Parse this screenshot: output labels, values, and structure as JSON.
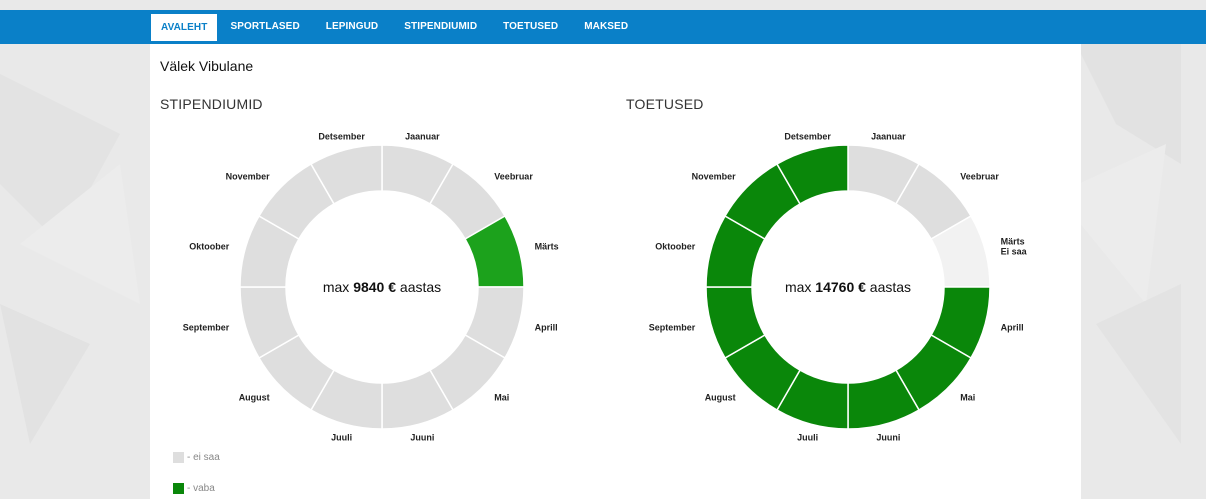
{
  "nav": {
    "items": [
      {
        "label": "AVALEHT",
        "active": true
      },
      {
        "label": "SPORTLASED",
        "active": false
      },
      {
        "label": "LEPINGUD",
        "active": false
      },
      {
        "label": "STIPENDIUMID",
        "active": false
      },
      {
        "label": "TOETUSED",
        "active": false
      },
      {
        "label": "MAKSED",
        "active": false
      }
    ]
  },
  "user_name": "Välek Vibulane",
  "colors": {
    "nav_bg": "#0a80c8",
    "vaba": "#0a870a",
    "vaba_light": "#1ca21c",
    "ei_saa": "#dedede",
    "light": "#f2f2f2"
  },
  "legend": {
    "ei_saa": "- ei saa",
    "vaba": "- vaba"
  },
  "chart_data": [
    {
      "type": "donut",
      "title": "STIPENDIUMID",
      "center": {
        "prefix": "max ",
        "amount": "9840 €",
        "suffix": " aastas"
      },
      "segments": [
        {
          "month": "Jaanuar",
          "status": "ei saa"
        },
        {
          "month": "Veebruar",
          "status": "ei saa"
        },
        {
          "month": "Märts",
          "status": "vaba"
        },
        {
          "month": "Aprill",
          "status": "ei saa"
        },
        {
          "month": "Mai",
          "status": "ei saa"
        },
        {
          "month": "Juuni",
          "status": "ei saa"
        },
        {
          "month": "Juuli",
          "status": "ei saa"
        },
        {
          "month": "August",
          "status": "ei saa"
        },
        {
          "month": "September",
          "status": "ei saa"
        },
        {
          "month": "Oktoober",
          "status": "ei saa"
        },
        {
          "month": "November",
          "status": "ei saa"
        },
        {
          "month": "Detsember",
          "status": "ei saa"
        }
      ]
    },
    {
      "type": "donut",
      "title": "TOETUSED",
      "center": {
        "prefix": "max ",
        "amount": "14760 €",
        "suffix": " aastas"
      },
      "segments": [
        {
          "month": "Jaanuar",
          "status": "ei saa"
        },
        {
          "month": "Veebruar",
          "status": "ei saa"
        },
        {
          "month": "Märts",
          "status": "light",
          "sublabel": "Ei saa"
        },
        {
          "month": "Aprill",
          "status": "vaba"
        },
        {
          "month": "Mai",
          "status": "vaba"
        },
        {
          "month": "Juuni",
          "status": "vaba"
        },
        {
          "month": "Juuli",
          "status": "vaba"
        },
        {
          "month": "August",
          "status": "vaba"
        },
        {
          "month": "September",
          "status": "vaba"
        },
        {
          "month": "Oktoober",
          "status": "vaba"
        },
        {
          "month": "November",
          "status": "vaba"
        },
        {
          "month": "Detsember",
          "status": "vaba"
        }
      ]
    }
  ]
}
